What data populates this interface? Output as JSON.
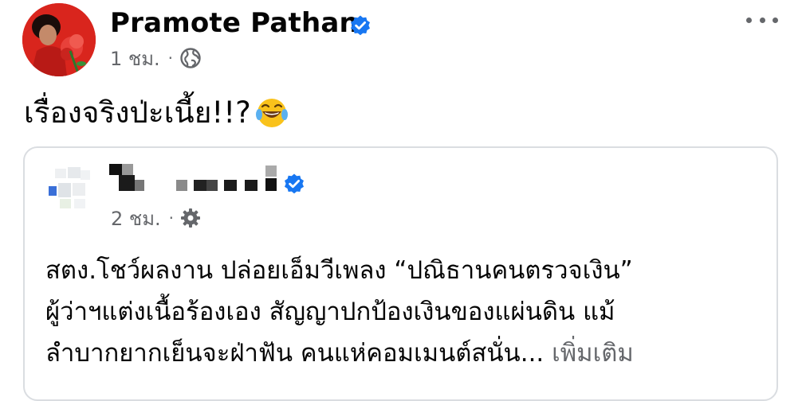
{
  "post": {
    "author_name": "Pramote Pathan",
    "time": "1 ชม.",
    "separator": "·",
    "audience_icon": "globe-icon",
    "caption": "เรื่องจริงป่ะเนี้ย!!?",
    "caption_emoji": "face-with-tears-of-joy-icon"
  },
  "shared_post": {
    "time": "2 ชม.",
    "separator": "·",
    "audience_icon": "gear-icon",
    "lines": [
      "สตง.โชว์ผลงาน ปล่อยเอ็มวีเพลง “ปณิธานคนตรวจเงิน”",
      "ผู้ว่าฯแต่งเนื้อร้องเอง สัญญาปกป้องเงินของแผ่นดิน แม้",
      "ลำบากยากเย็นจะฝ่าฟัน คนแห่คอมเมนต์สนั่น..."
    ],
    "see_more": "เพิ่มเติม"
  },
  "colors": {
    "verified_blue": "#1877f2",
    "secondary_text": "#65676b",
    "primary_text": "#050505",
    "border": "#dadde1"
  }
}
